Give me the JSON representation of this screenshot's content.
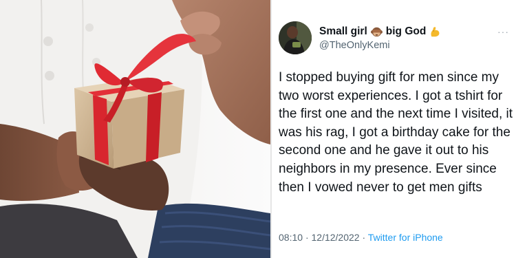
{
  "tweet": {
    "display_name_part1": "Small girl",
    "display_name_part2": "big God",
    "emoji_1": "see-no-evil-monkey-icon",
    "emoji_2": "flexed-biceps-icon",
    "handle": "@TheOnlyKemi",
    "more_label": "···",
    "body": "I stopped buying gift for men since my two worst experiences. I got a tshirt for the first one and the next time I visited, it was his rag, I got a birthday cake for the second one and he gave it out to his neighbors in my presence. Ever since then I vowed never to get men gifts",
    "time": "08:10",
    "separator": "·",
    "date": "12/12/2022",
    "source": "Twitter for iPhone"
  },
  "colors": {
    "text": "#0f1419",
    "secondary": "#536471",
    "link": "#1d9bf0",
    "ribbon": "#d8262e",
    "gift_paper": "#cdb596"
  }
}
